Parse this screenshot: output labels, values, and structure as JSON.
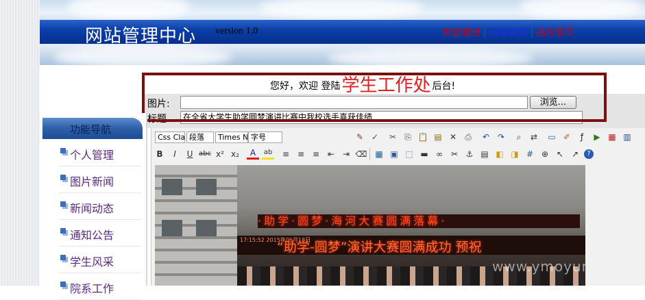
{
  "header": {
    "site_title": "网站管理中心",
    "version": "version 1.0",
    "nav": [
      {
        "label": "安全退出",
        "color": "#d40000"
      },
      {
        "label": "网站首页",
        "color": "#1e2fe0"
      },
      {
        "label": "后台首页",
        "color": "#d40000"
      }
    ],
    "nav_separator": "|"
  },
  "welcome": {
    "prefix": "您好，欢迎 登陆",
    "highlight": "学生工作处",
    "suffix": "后台!"
  },
  "form": {
    "image_label": "图片:",
    "image_value": "",
    "browse_label": "浏览...",
    "title_label": "标题",
    "title_value": "在全省大学生助学圆梦演讲比赛中我校选手喜获佳绩"
  },
  "sidebar": {
    "heading": "功能导航",
    "items": [
      {
        "label": "个人管理"
      },
      {
        "label": "图片新闻"
      },
      {
        "label": "新闻动态"
      },
      {
        "label": "通知公告"
      },
      {
        "label": "学生风采"
      },
      {
        "label": "院系工作"
      }
    ]
  },
  "editor": {
    "css_class_select": "Css Clas",
    "format_select": "段落",
    "font_select": "Times Ne",
    "size_select": "字号",
    "toolbar1_icons": [
      "styleprops-icon",
      "spellcheck-icon",
      "cut-icon",
      "copy-icon",
      "paste-icon",
      "paste-text-icon",
      "delete-icon",
      "print-icon",
      "undo-icon",
      "redo-icon",
      "find-icon",
      "replace-icon",
      "image-icon",
      "edit-image-icon",
      "flash-icon",
      "media-icon",
      "pdf-icon",
      "template-icon"
    ],
    "toolbar2": [
      {
        "icon": "bold-icon",
        "glyph": "B"
      },
      {
        "icon": "italic-icon",
        "glyph": "I"
      },
      {
        "icon": "underline-icon",
        "glyph": "U"
      },
      {
        "icon": "strikethrough-icon",
        "glyph": "abc"
      },
      {
        "icon": "superscript-icon",
        "glyph": "x²"
      },
      {
        "icon": "subscript-icon",
        "glyph": "x₂"
      },
      {
        "icon": "font-color-icon",
        "glyph": "A"
      },
      {
        "icon": "highlight-icon",
        "glyph": "ab"
      },
      {
        "icon": "align-left-icon",
        "glyph": "≡"
      },
      {
        "icon": "align-center-icon",
        "glyph": "≡"
      },
      {
        "icon": "align-right-icon",
        "glyph": "≡"
      },
      {
        "icon": "outdent-icon",
        "glyph": "⇤"
      },
      {
        "icon": "indent-icon",
        "glyph": "⇥"
      },
      {
        "icon": "eraser-icon",
        "glyph": "⌫"
      },
      {
        "icon": "table-icon",
        "glyph": "▦"
      },
      {
        "icon": "table-cells-icon",
        "glyph": "▣"
      },
      {
        "icon": "select-all-icon",
        "glyph": "⬚"
      },
      {
        "icon": "hr-icon",
        "glyph": "▬"
      },
      {
        "icon": "link-icon",
        "glyph": "∞"
      },
      {
        "icon": "unlink-icon",
        "glyph": "✂"
      },
      {
        "icon": "anchor-icon",
        "glyph": "⚓"
      },
      {
        "icon": "page-break-icon",
        "glyph": "▤"
      },
      {
        "icon": "layer-icon",
        "glyph": "◧"
      },
      {
        "icon": "layer-move-icon",
        "glyph": "◨"
      },
      {
        "icon": "grid-icon",
        "glyph": "#"
      },
      {
        "icon": "insert-icon",
        "glyph": "⊕"
      },
      {
        "icon": "pointer-icon",
        "glyph": "↖"
      },
      {
        "icon": "pointer-plus-icon",
        "glyph": "↗"
      },
      {
        "icon": "help-icon",
        "glyph": "?"
      }
    ]
  },
  "photo": {
    "led_top": "·助学·圆梦·海河大赛圆满落幕·",
    "led_clock": "17:15:52 2015年06月18日",
    "led_main": "“助学-圆梦”演讲大赛圆满成功  预祝",
    "watermark": "www.ymoyun.org"
  }
}
